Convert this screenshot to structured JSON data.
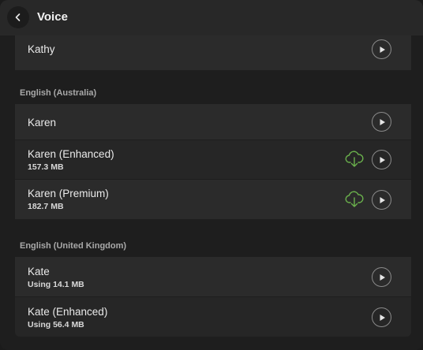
{
  "header": {
    "title": "Voice"
  },
  "voices_top": [
    {
      "name": "Kathy"
    }
  ],
  "sections": [
    {
      "label": "English (Australia)",
      "voices": [
        {
          "name": "Karen",
          "size": ""
        },
        {
          "name": "Karen (Enhanced)",
          "size": "157.3 MB"
        },
        {
          "name": "Karen (Premium)",
          "size": "182.7 MB"
        }
      ]
    },
    {
      "label": "English (United Kingdom)",
      "voices": [
        {
          "name": "Kate",
          "size": "Using 14.1 MB"
        },
        {
          "name": "Kate (Enhanced)",
          "size": "Using 56.4 MB"
        }
      ]
    }
  ],
  "colors": {
    "download_icon": "#6ab04c",
    "play_icon": "#e6e6e6"
  }
}
